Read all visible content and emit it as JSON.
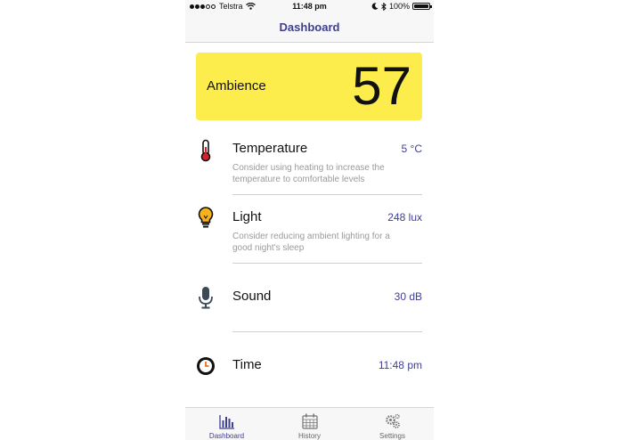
{
  "status_bar": {
    "carrier": "Telstra",
    "time": "11:48 pm",
    "battery": "100%"
  },
  "nav": {
    "title": "Dashboard"
  },
  "ambience": {
    "label": "Ambience",
    "value": "57",
    "color": "#fcec4c"
  },
  "rows": [
    {
      "icon": "thermometer-icon",
      "title": "Temperature",
      "value": "5 °C",
      "description": "Consider using heating to increase the temperature to comfortable levels"
    },
    {
      "icon": "light-bulb-icon",
      "title": "Light",
      "value": "248 lux",
      "description": "Consider reducing ambient lighting for a good night's sleep"
    },
    {
      "icon": "microphone-icon",
      "title": "Sound",
      "value": "30 dB",
      "description": ""
    },
    {
      "icon": "clock-icon",
      "title": "Time",
      "value": "11:48 pm",
      "description": ""
    }
  ],
  "tabs": [
    {
      "label": "Dashboard",
      "icon": "bar-chart-icon",
      "active": true
    },
    {
      "label": "History",
      "icon": "calendar-icon",
      "active": false
    },
    {
      "label": "Settings",
      "icon": "gears-icon",
      "active": false
    }
  ],
  "colors": {
    "accent": "#3f3f92",
    "card": "#fcec4c"
  }
}
